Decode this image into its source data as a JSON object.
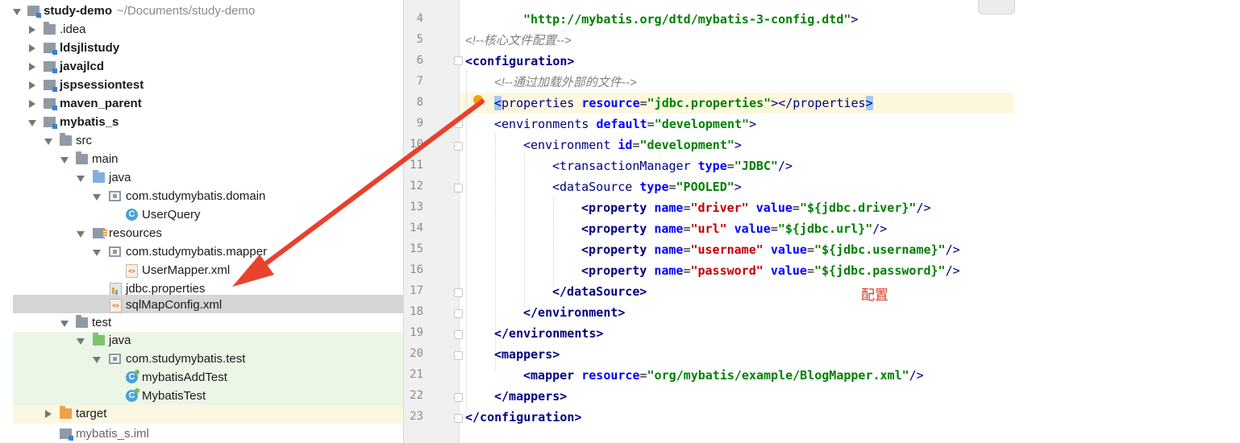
{
  "tree": {
    "root": {
      "name": "study-demo",
      "path": "~/Documents/study-demo"
    },
    "items": [
      {
        "label": ".idea"
      },
      {
        "label": "ldsjlistudy"
      },
      {
        "label": "javajlcd"
      },
      {
        "label": "jspsessiontest"
      },
      {
        "label": "maven_parent"
      },
      {
        "label": "mybatis_s"
      },
      {
        "label": "src"
      },
      {
        "label": "main"
      },
      {
        "label": "java"
      },
      {
        "label": "com.studymybatis.domain"
      },
      {
        "label": "UserQuery",
        "icon_text": "C"
      },
      {
        "label": "resources"
      },
      {
        "label": "com.studymybatis.mapper"
      },
      {
        "label": "UserMapper.xml",
        "icon_text": "<>"
      },
      {
        "label": "jdbc.properties"
      },
      {
        "label": "sqlMapConfig.xml",
        "icon_text": "<>"
      },
      {
        "label": "test"
      },
      {
        "label": "java"
      },
      {
        "label": "com.studymybatis.test"
      },
      {
        "label": "mybatisAddTest",
        "icon_text": "C"
      },
      {
        "label": "MybatisTest",
        "icon_text": "C"
      },
      {
        "label": "target"
      },
      {
        "label": "mybatis_s.iml"
      }
    ]
  },
  "editor": {
    "line_numbers": [
      "4",
      "5",
      "6",
      "7",
      "8",
      "9",
      "10",
      "11",
      "12",
      "13",
      "14",
      "15",
      "16",
      "17",
      "18",
      "19",
      "20",
      "21",
      "22",
      "23"
    ],
    "code": {
      "l4_dtd": "\"http://mybatis.org/dtd/mybatis-3-config.dtd\"",
      "l4_end": ">",
      "l5_comment": "<!--核心文件配置-->",
      "l6_open": "<configuration>",
      "l7_comment": "<!--通过加载外部的文件-->",
      "l8_tag": "properties",
      "l8_attr": "resource",
      "l8_value": "\"jdbc.properties\"",
      "l9_tag": "environments",
      "l9_attr": "default",
      "l9_value": "\"development\"",
      "l10_tag": "environment",
      "l10_attr": "id",
      "l10_value": "\"development\"",
      "l11_tag": "transactionManager",
      "l11_attr": "type",
      "l11_value": "\"JDBC\"",
      "l12_tag": "dataSource",
      "l12_attr": "type",
      "l12_value": "\"POOLED\"",
      "prop_tag": "property",
      "prop_name_attr": "name",
      "prop_value_attr": "value",
      "l13_name": "\"driver\"",
      "l13_value": "\"${jdbc.driver}\"",
      "l14_name": "\"url\"",
      "l14_value": "\"${jdbc.url}\"",
      "l15_name": "\"username\"",
      "l15_value": "\"${jdbc.username}\"",
      "l16_name": "\"password\"",
      "l16_value": "\"${jdbc.password}\"",
      "l17_close": "</dataSource>",
      "l18_close": "</environment>",
      "l19_close": "</environments>",
      "l20_open": "<mappers>",
      "l21_tag": "mapper",
      "l21_attr": "resource",
      "l21_value": "\"org/mybatis/example/BlogMapper.xml\"",
      "l22_close": "</mappers>",
      "l23_close": "</configuration>"
    }
  },
  "annotation": {
    "note": "配置",
    "color": "#d43c2a"
  }
}
